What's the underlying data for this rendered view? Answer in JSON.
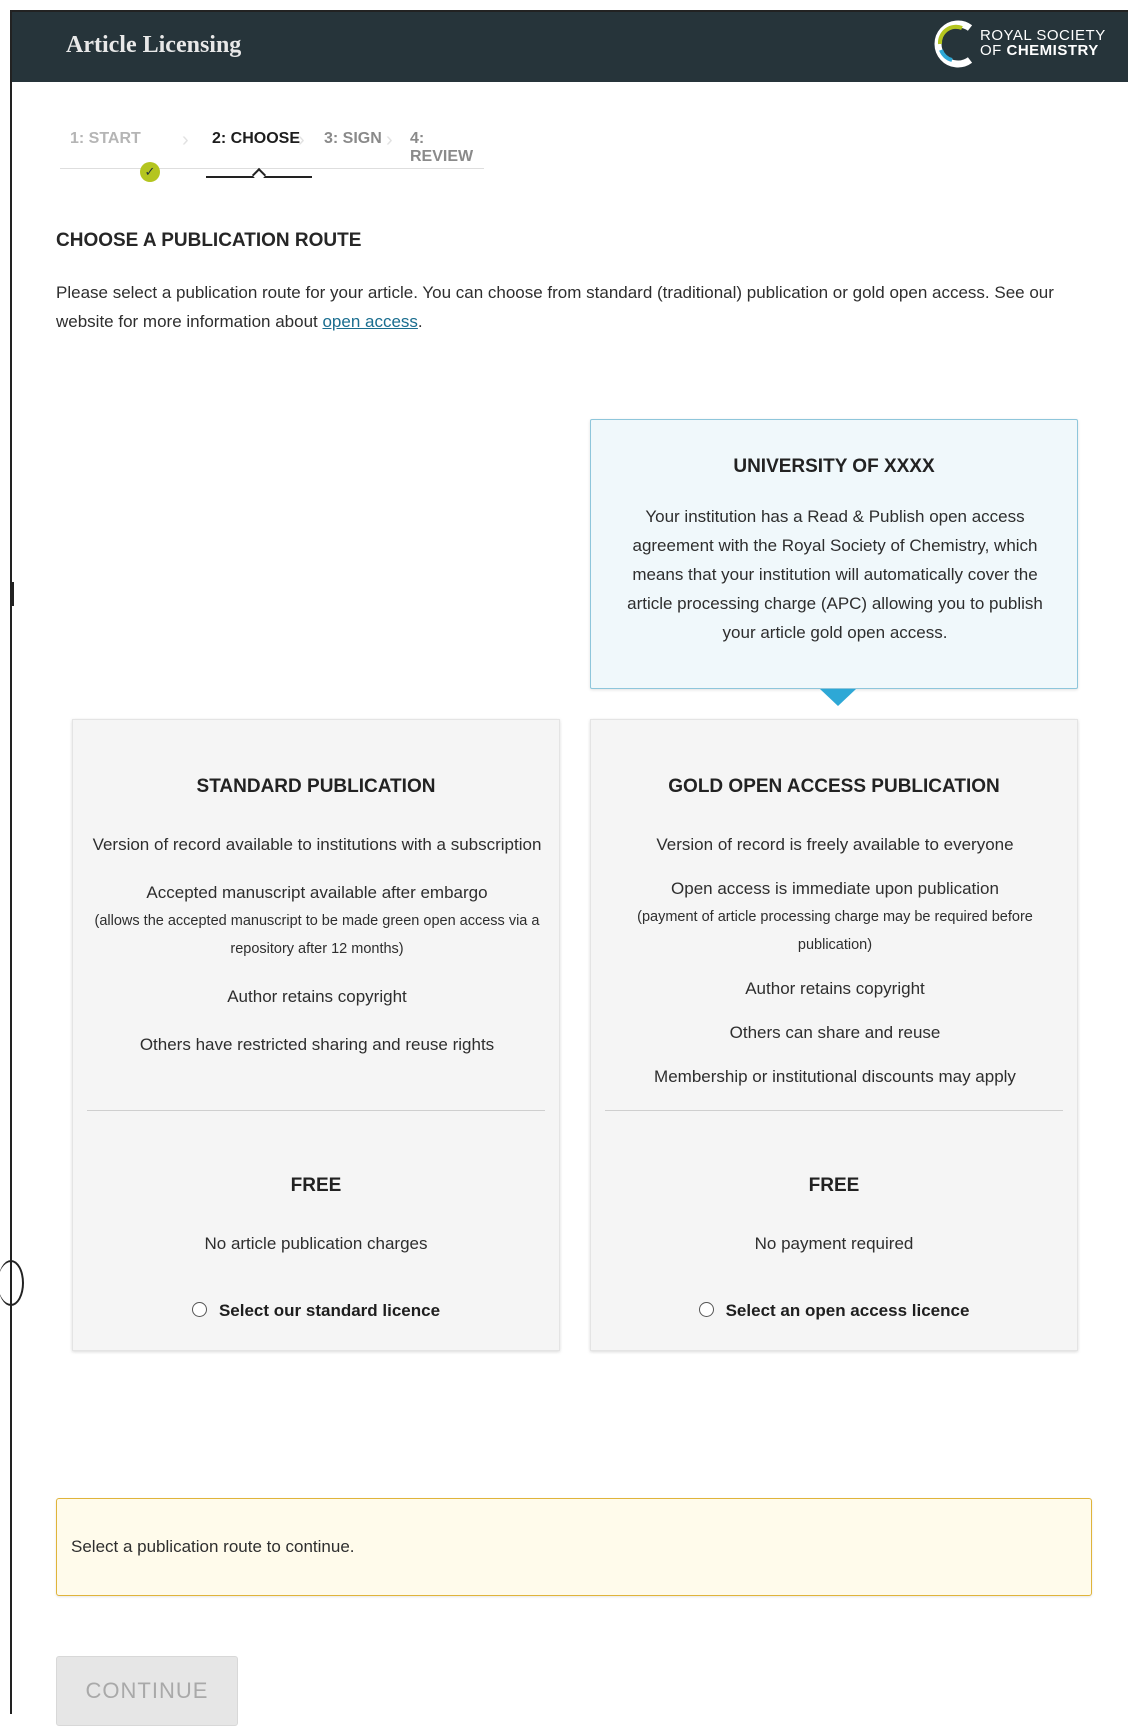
{
  "header": {
    "app_title": "Article Licensing",
    "logo_line1": "ROYAL SOCIETY",
    "logo_line2_prefix": "OF",
    "logo_line2_bold": "CHEMISTRY",
    "logo_icon": "rsc-logo-icon"
  },
  "steps": [
    {
      "label": "1: START",
      "state": "done"
    },
    {
      "label": "2: CHOOSE",
      "state": "active"
    },
    {
      "label": "3: SIGN",
      "state": "pending"
    },
    {
      "label": "4: REVIEW",
      "state": "pending"
    }
  ],
  "page": {
    "title": "CHOOSE A PUBLICATION ROUTE",
    "intro_before_link": "Please select a publication route for your article. You can choose from standard (traditional) publication or gold open access. See our website for more information about ",
    "intro_link": "open access",
    "intro_after_link": "."
  },
  "callout": {
    "title": "UNIVERSITY OF XXXX",
    "body": "Your institution has a Read & Publish open access agreement with the Royal Society of Chemistry, which means that your institution will automatically cover the article processing charge (APC) allowing you to publish your article gold open access."
  },
  "cards": {
    "standard": {
      "title": "STANDARD PUBLICATION",
      "features": [
        {
          "text": "Version of record available to institutions with a subscription"
        },
        {
          "text": "Accepted manuscript available after embargo",
          "note": "(allows the accepted manuscript to be made green open access via a repository after 12 months)"
        },
        {
          "text": "Author retains copyright"
        },
        {
          "text": "Others have restricted sharing and reuse rights"
        }
      ],
      "price": "FREE",
      "price_sub": "No article publication charges",
      "radio_label": "Select our standard licence",
      "selected": false
    },
    "gold": {
      "title": "GOLD OPEN ACCESS PUBLICATION",
      "features": [
        {
          "text": "Version of record is freely available to everyone"
        },
        {
          "text": "Open access is immediate upon publication",
          "note": "(payment of article processing charge may be required before publication)"
        },
        {
          "text": "Author retains copyright"
        },
        {
          "text": "Others can share and reuse"
        },
        {
          "text": "Membership or institutional discounts may apply"
        }
      ],
      "price": "FREE",
      "price_sub": "No payment required",
      "radio_label": "Select an open access licence",
      "selected": false
    }
  },
  "notice": {
    "text": "Select a publication route to continue."
  },
  "continue_button": {
    "label": "CONTINUE",
    "enabled": false
  },
  "colors": {
    "header_bg": "#26343a",
    "callout_border": "#8ec6db",
    "callout_pointer": "#2ea8d6",
    "notice_bg": "#fffbeb",
    "notice_border": "#e0b43a",
    "check_badge": "#b4c51f",
    "link": "#1a6d8f"
  }
}
